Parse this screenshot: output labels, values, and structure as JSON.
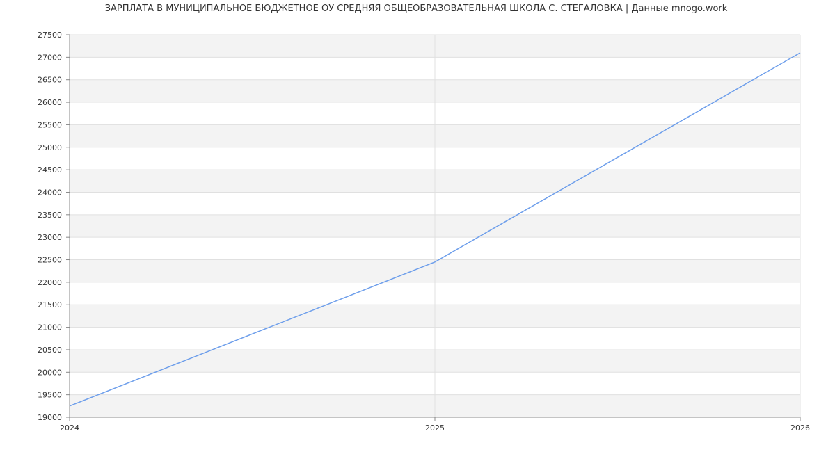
{
  "chart_data": {
    "type": "line",
    "title": "ЗАРПЛАТА В МУНИЦИПАЛЬНОЕ БЮДЖЕТНОЕ ОУ СРЕДНЯЯ ОБЩЕОБРАЗОВАТЕЛЬНАЯ ШКОЛА С. СТЕГАЛОВКА | Данные mnogo.work",
    "xlabel": "",
    "ylabel": "",
    "x": [
      2024,
      2025,
      2026
    ],
    "x_tick_labels": [
      "2024",
      "2025",
      "2026"
    ],
    "series": [
      {
        "values": [
          19250,
          22450,
          27100
        ],
        "color": "#6d9eeb"
      }
    ],
    "ylim": [
      19000,
      27500
    ],
    "xlim": [
      2024,
      2026
    ],
    "y_ticks": [
      19000,
      19500,
      20000,
      20500,
      21000,
      21500,
      22000,
      22500,
      23000,
      23500,
      24000,
      24500,
      25000,
      25500,
      26000,
      26500,
      27000,
      27500
    ],
    "y_tick_labels": [
      "19000",
      "19500",
      "20000",
      "20500",
      "21000",
      "21500",
      "22000",
      "22500",
      "23000",
      "23500",
      "24000",
      "24500",
      "25000",
      "25500",
      "26000",
      "26500",
      "27000",
      "27500"
    ],
    "grid": true,
    "band_color": "#f3f3f3",
    "grid_color": "#e0e0e0",
    "axis_color": "#888888"
  }
}
